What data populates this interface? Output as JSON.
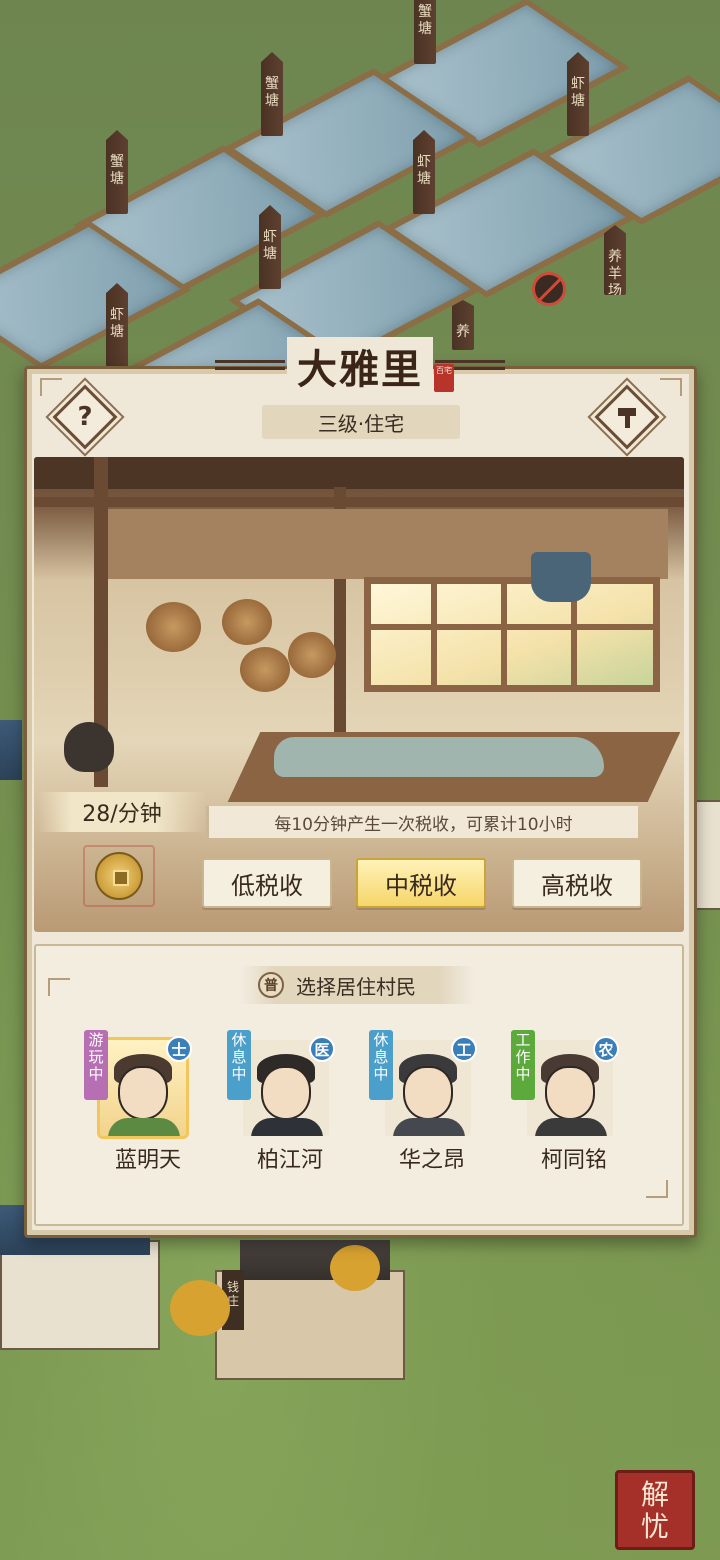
{
  "map": {
    "pond_signs": [
      "蟹塘",
      "虾塘",
      "蟹塘",
      "虾塘",
      "虾塘",
      "虾塘",
      "虾塘"
    ],
    "farm_sign": "养羊场",
    "farm_sign_partial": "养",
    "bank_sign": "钱庄"
  },
  "dialog": {
    "title": "大雅里",
    "seal_text": "百宅",
    "subtitle": "三级·住宅",
    "help_icon": "question-icon",
    "build_icon": "hammer-icon"
  },
  "tax": {
    "rate": "28/分钟",
    "info": "每10分钟产生一次税收，可累计10小时",
    "coin_icon": "copper-coin-icon",
    "options": [
      {
        "label": "低税收",
        "active": false
      },
      {
        "label": "中税收",
        "active": true
      },
      {
        "label": "高税收",
        "active": false
      }
    ]
  },
  "residents": {
    "badge": "普",
    "title": "选择居住村民",
    "list": [
      {
        "name": "蓝明天",
        "status": "游玩中",
        "profession": "士",
        "status_color": "#b76fb3",
        "selected": true
      },
      {
        "name": "柏江河",
        "status": "休息中",
        "profession": "医",
        "status_color": "#4a9fcb",
        "selected": false
      },
      {
        "name": "华之昂",
        "status": "休息中",
        "profession": "工",
        "status_color": "#4a9fcb",
        "selected": false
      },
      {
        "name": "柯同铭",
        "status": "工作中",
        "profession": "农",
        "status_color": "#5daa3c",
        "selected": false
      }
    ]
  },
  "corner_button": "解忧"
}
